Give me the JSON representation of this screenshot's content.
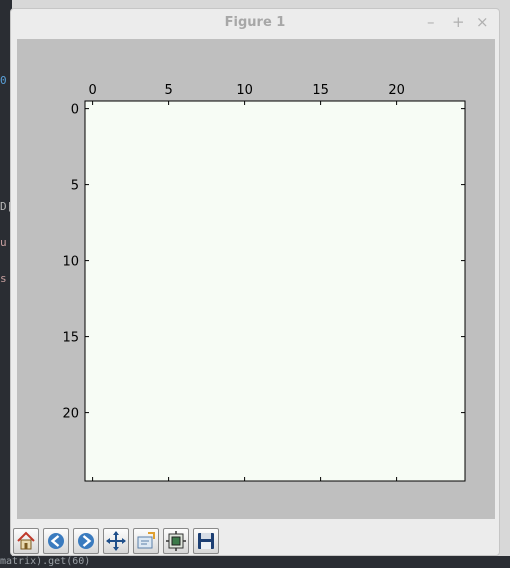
{
  "window": {
    "title": "Figure 1",
    "minimize": "–",
    "maximize": "+",
    "close": "×"
  },
  "background_code": {
    "frag1": "0",
    "frag2": "D[",
    "frag3": "u",
    "frag4": "s",
    "bottom": "matrix).get(60)"
  },
  "toolbar": {
    "buttons": [
      {
        "name": "home-button",
        "icon": "home-icon"
      },
      {
        "name": "back-button",
        "icon": "arrow-left-icon"
      },
      {
        "name": "forward-button",
        "icon": "arrow-right-icon"
      },
      {
        "name": "pan-button",
        "icon": "move-icon"
      },
      {
        "name": "zoom-button",
        "icon": "zoom-rect-icon"
      },
      {
        "name": "subplots-button",
        "icon": "subplots-icon"
      },
      {
        "name": "save-button",
        "icon": "floppy-disk-icon"
      }
    ]
  },
  "chart_data": {
    "type": "heatmap",
    "colormap": "Greens",
    "xticks": [
      0,
      5,
      10,
      15,
      20
    ],
    "yticks": [
      0,
      5,
      10,
      15,
      20
    ],
    "xlim": [
      -0.5,
      24.5
    ],
    "ylim": [
      24.5,
      -0.5
    ],
    "grid": false,
    "xaxis_position": "top",
    "levels": {
      "0": "#f7fcf5",
      "1": "#c7e9c0",
      "2": "#74c476",
      "3": "#238b45",
      "4": "#00441b"
    },
    "values": [
      "0000000000000000000000000",
      "0000000000000000000000000",
      "0000000000000000000000000",
      "0000000000000000000000000",
      "0000000000000000000000000",
      "0000000000000000000000000",
      "0000000000000000000000000",
      "0000000000000000000000000",
      "0000000000000000000000000",
      "0000000000000000000000000",
      "0000000000000000000000000",
      "0000000000000000000000000",
      "0000000000000000000000000",
      "0000000000000000000000000",
      "0000000000000000000000000",
      "0000000000000000000000000",
      "0000000000000000000000000",
      "0000000000000000000000000",
      "0000000000000000000000000",
      "0000000000000000000000000",
      "0000000000000000000000000",
      "0000000000000000000000000",
      "0000000000000000000000000",
      "0000000000000000000000000",
      "0000000000000000000000000"
    ]
  }
}
